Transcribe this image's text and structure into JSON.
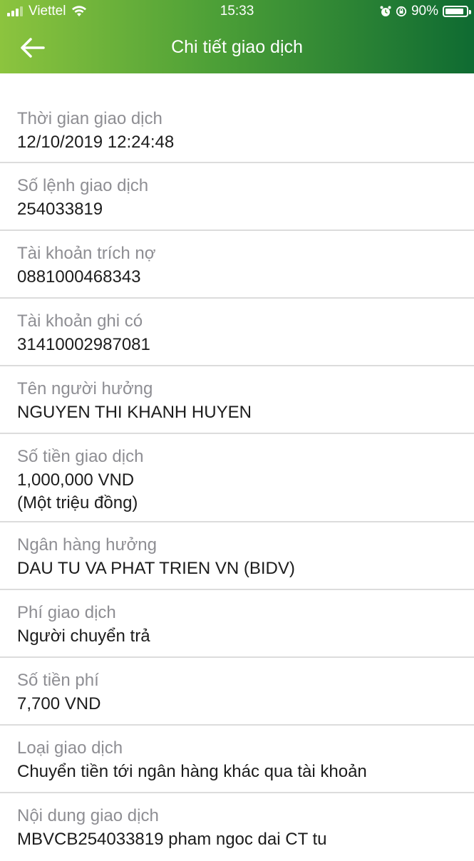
{
  "status": {
    "carrier": "Viettel",
    "time": "15:33",
    "battery_percent": 90,
    "battery_text": "90%"
  },
  "header": {
    "title": "Chi tiết giao dịch",
    "back_icon": "arrow-left-icon"
  },
  "colors": {
    "header_gradient_start": "#8cc43e",
    "header_gradient_end": "#0f6b32",
    "label": "#8e8e93",
    "value": "#1c1c1c",
    "divider": "#dcdcdc"
  },
  "details": [
    {
      "label": "Thời gian giao dịch",
      "value": "12/10/2019 12:24:48"
    },
    {
      "label": "Số lệnh giao dịch",
      "value": "254033819"
    },
    {
      "label": "Tài khoản trích nợ",
      "value": "0881000468343"
    },
    {
      "label": "Tài khoản ghi có",
      "value": "31410002987081"
    },
    {
      "label": "Tên người hưởng",
      "value": "NGUYEN THI KHANH HUYEN"
    },
    {
      "label": "Số tiền giao dịch",
      "value": "1,000,000 VND",
      "value2": "(Một triệu đồng)"
    },
    {
      "label": "Ngân hàng hưởng",
      "value": "DAU TU VA PHAT TRIEN VN (BIDV)"
    },
    {
      "label": "Phí giao dịch",
      "value": "Người chuyển trả"
    },
    {
      "label": "Số tiền phí",
      "value": "7,700 VND"
    },
    {
      "label": "Loại giao dịch",
      "value": "Chuyển tiền tới ngân hàng khác qua tài khoản"
    },
    {
      "label": "Nội dung giao dịch",
      "value": "MBVCB254033819 pham ngoc dai CT tu"
    }
  ]
}
